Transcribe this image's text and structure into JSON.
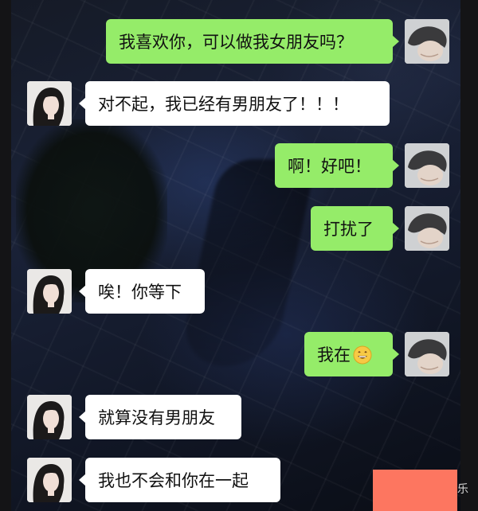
{
  "chat": {
    "messages": [
      {
        "sender": "me",
        "text": "我喜欢你，可以做我女朋友吗？"
      },
      {
        "sender": "her",
        "text": "对不起，我已经有男朋友了！！！"
      },
      {
        "sender": "me",
        "text": "啊！好吧！"
      },
      {
        "sender": "me",
        "text": "打扰了"
      },
      {
        "sender": "her",
        "text": "唉！你等下"
      },
      {
        "sender": "me",
        "text": "我在",
        "emoji": "grinning-face-emoji"
      },
      {
        "sender": "her",
        "text": "就算没有男朋友"
      },
      {
        "sender": "her",
        "text": "我也不会和你在一起"
      }
    ]
  },
  "watermark": {
    "text": "乐"
  },
  "colors": {
    "my_bubble": "#95ec69",
    "her_bubble": "#ffffff",
    "overlay_box": "#fd7660",
    "background": "#1a2238"
  },
  "icons": {
    "her_avatar": "girl-avatar-icon",
    "my_avatar": "boy-avatar-icon",
    "emoji": "grinning-face-emoji"
  }
}
